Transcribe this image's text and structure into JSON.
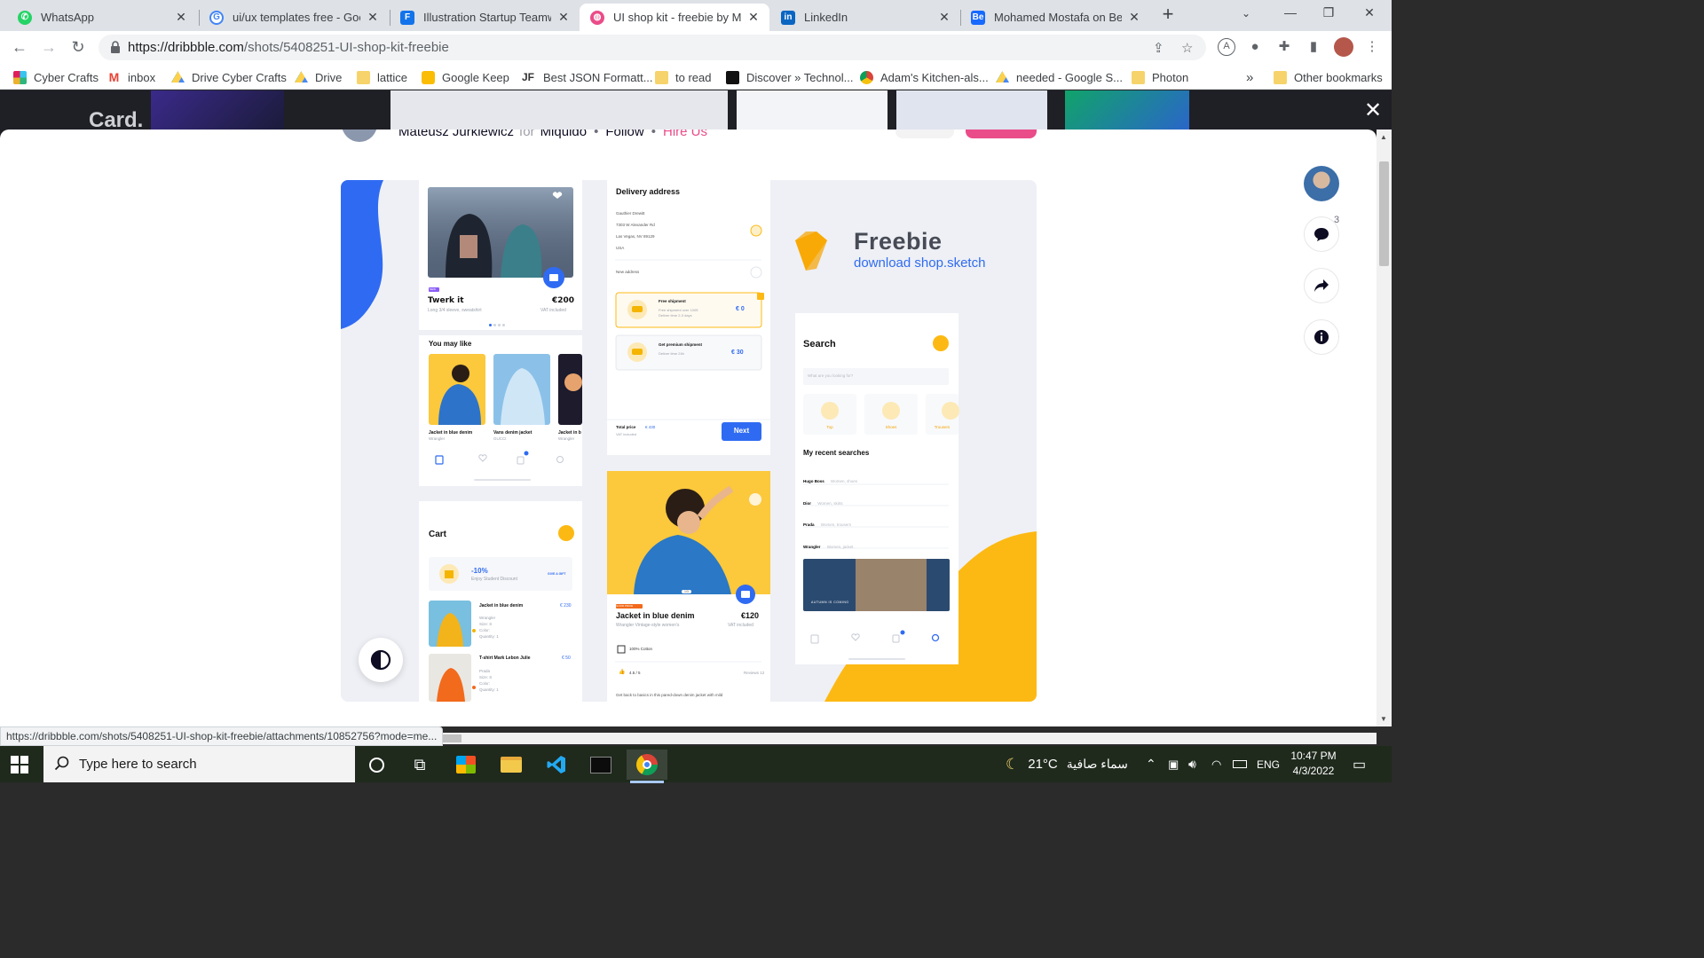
{
  "browser": {
    "tabs": [
      {
        "title": "WhatsApp",
        "icon": "whatsapp-icon",
        "color": "#25d366",
        "active": false
      },
      {
        "title": "ui/ux templates free - Goog",
        "icon": "google-icon",
        "color": "#4285f4",
        "active": false
      },
      {
        "title": "Illustration Startup Teamwo",
        "icon": "freepik-icon",
        "color": "#1273eb",
        "active": false
      },
      {
        "title": "UI shop kit - freebie by Mat",
        "icon": "dribbble-icon",
        "color": "#ea4c89",
        "active": true
      },
      {
        "title": "LinkedIn",
        "icon": "linkedin-icon",
        "color": "#0a66c2",
        "active": false
      },
      {
        "title": "Mohamed Mostafa on Beha",
        "icon": "behance-icon",
        "color": "#1769ff",
        "active": false
      }
    ],
    "address": {
      "host": "https://dribbble.com",
      "path": "/shots/5408251-UI-shop-kit-freebie"
    },
    "bookmarks": [
      {
        "label": "Cyber Crafts",
        "icon": "slack-icon",
        "color": "#e01e5a"
      },
      {
        "label": "inbox",
        "icon": "gmail-icon",
        "color": "#ea4335"
      },
      {
        "label": "Drive Cyber Crafts",
        "icon": "drive-icon",
        "color": "#1fa463"
      },
      {
        "label": "Drive",
        "icon": "drive-icon",
        "color": "#1fa463"
      },
      {
        "label": "lattice",
        "icon": "folder-icon",
        "color": "#f6d46b"
      },
      {
        "label": "Google Keep",
        "icon": "keep-icon",
        "color": "#fbbc04"
      },
      {
        "label": "Best JSON Formatt...",
        "icon": "jf-icon",
        "color": "#333333"
      },
      {
        "label": "to read",
        "icon": "folder-icon",
        "color": "#f6d46b"
      },
      {
        "label": "Discover » Technol...",
        "icon": "discover-icon",
        "color": "#111111"
      },
      {
        "label": "Adam's Kitchen-als...",
        "icon": "chrome-icon",
        "color": "#db4437"
      },
      {
        "label": "needed - Google S...",
        "icon": "drive-icon",
        "color": "#1fa463"
      },
      {
        "label": "Photon",
        "icon": "folder-icon",
        "color": "#f6d46b"
      }
    ],
    "more_bookmarks": "»",
    "other_bookmarks": "Other bookmarks"
  },
  "dribbble": {
    "backdrop_word": "Card.",
    "author": {
      "name": "Mateusz Jurkiewicz",
      "for_word": "for",
      "team": "Miquido",
      "follow": "Follow",
      "hire": "Hire Us"
    },
    "comments_count": "3",
    "status_url": "https://dribbble.com/shots/5408251-UI-shop-kit-freebie/attachments/10852756?mode=me..."
  },
  "shot": {
    "product": {
      "name": "Twerk it",
      "price": "€200",
      "desc": "Long 3/4 sleeve, sweatshirt",
      "vat": "VAT included",
      "badge": "NEW"
    },
    "you_may_like": "You may like",
    "like_items": [
      {
        "name": "Jacket in blue denim",
        "brand": "Wrangler"
      },
      {
        "name": "Vans denim jacket",
        "brand": "GUCCI"
      },
      {
        "name": "Jacket in b",
        "brand": "Wrangler"
      }
    ],
    "delivery": {
      "title": "Delivery address",
      "lines": [
        "Gauthier Drewitt",
        "7303 W Alexander Rd",
        "Las Vegas, NV 89129",
        "USA"
      ],
      "new_address": "New address",
      "free_title": "Free shipment",
      "free_sub1": "Free shipment over 100€",
      "free_sub2": "Deliver time 2-3 days",
      "free_price": "€ 0",
      "premium_title": "Get premium shipment",
      "premium_sub": "Deliver time 24h",
      "premium_price": "€ 30",
      "total_label": "Total price",
      "total_value": "€ 430",
      "total_sub": "VAT included",
      "next": "Next"
    },
    "freebie": {
      "title": "Freebie",
      "subtitle": "download shop.sketch"
    },
    "search": {
      "title": "Search",
      "placeholder": "What are you looking for?",
      "categories": [
        "Top",
        "Shoes",
        "Trousers"
      ],
      "recent_title": "My recent searches",
      "recent": [
        {
          "brand": "Hugo Boss",
          "desc": "Women, shoes"
        },
        {
          "brand": "Dior",
          "desc": "Women, skirts"
        },
        {
          "brand": "Prada",
          "desc": "Women, trousers"
        },
        {
          "brand": "Wrangler",
          "desc": "Women, jacket"
        }
      ],
      "banner": "AUTUMN IS COMING"
    },
    "cart": {
      "title": "Cart",
      "discount": "-10%",
      "discount_sub": "Enjoy Student Discount",
      "gift": "GIVE A GIFT",
      "items": [
        {
          "name": "Jacket in blue denim",
          "price": "€ 230",
          "brand": "Wrangler",
          "size": "Size: S",
          "color": "Color:",
          "qty": "Quantity: 1"
        },
        {
          "name": "T-shirt Mark Lebon Julie",
          "price": "€ 50",
          "brand": "Prada",
          "size": "Size: S",
          "color": "Color:",
          "qty": "Quantity: 1"
        }
      ]
    },
    "detail": {
      "badge": "GOOD PRICE",
      "name": "Jacket in blue denim",
      "price": "€120",
      "desc": "Wrangler Vintage-style women's",
      "vat": "VAT included",
      "material": "100% Cotton",
      "rating": "4.5 / 5",
      "reviews": "Reviews 12",
      "blurb": "Get back to basics in this pared-down denim jacket with mild",
      "pager": "1/3"
    }
  },
  "taskbar": {
    "search_placeholder": "Type here to search",
    "weather": "21°C",
    "weather_desc": "سماء صافية",
    "lang": "ENG",
    "time": "10:47 PM",
    "date": "4/3/2022"
  }
}
